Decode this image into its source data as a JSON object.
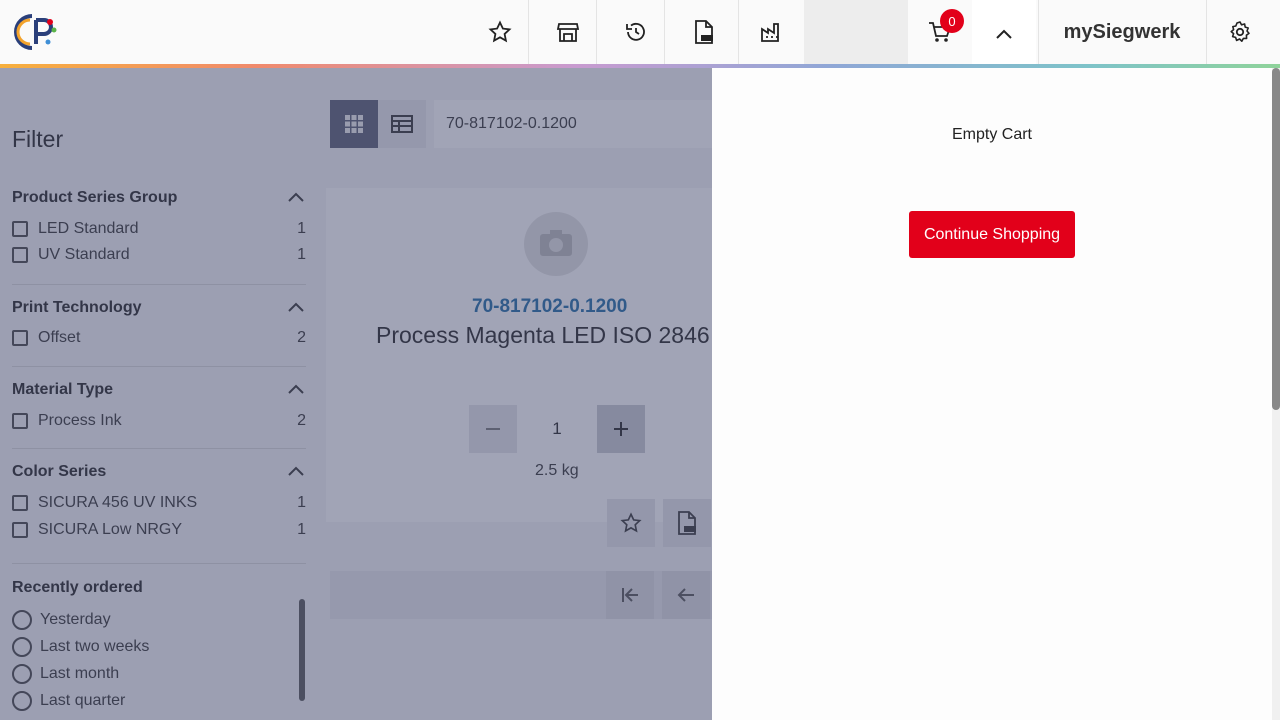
{
  "header": {
    "brand": "mySiegwerk",
    "cart_count": "0",
    "icons": [
      "star-icon",
      "store-icon",
      "history-icon",
      "pdf-icon",
      "factory-icon",
      "cart-icon",
      "chevron-up-icon",
      "gear-icon"
    ]
  },
  "filter": {
    "title": "Filter",
    "groups": [
      {
        "label": "Product Series Group",
        "options": [
          {
            "label": "LED Standard",
            "count": "1"
          },
          {
            "label": "UV Standard",
            "count": "1"
          }
        ]
      },
      {
        "label": "Print Technology",
        "options": [
          {
            "label": "Offset",
            "count": "2"
          }
        ]
      },
      {
        "label": "Material Type",
        "options": [
          {
            "label": "Process Ink",
            "count": "2"
          }
        ]
      },
      {
        "label": "Color Series",
        "options": [
          {
            "label": "SICURA 456 UV INKS",
            "count": "1"
          },
          {
            "label": "SICURA Low NRGY",
            "count": "1"
          }
        ]
      }
    ],
    "recent": {
      "label": "Recently ordered",
      "options": [
        "Yesterday",
        "Last two weeks",
        "Last month",
        "Last quarter"
      ]
    }
  },
  "search": {
    "value": "70-817102-0.1200"
  },
  "product": {
    "code": "70-817102-0.1200",
    "name": "Process Magenta LED ISO 2846",
    "quantity": "1",
    "weight": "2.5 kg"
  },
  "cart": {
    "empty_text": "Empty Cart",
    "continue_label": "Continue Shopping"
  },
  "colors": {
    "accent_red": "#e2001a",
    "link_blue": "#1f6aa5"
  }
}
